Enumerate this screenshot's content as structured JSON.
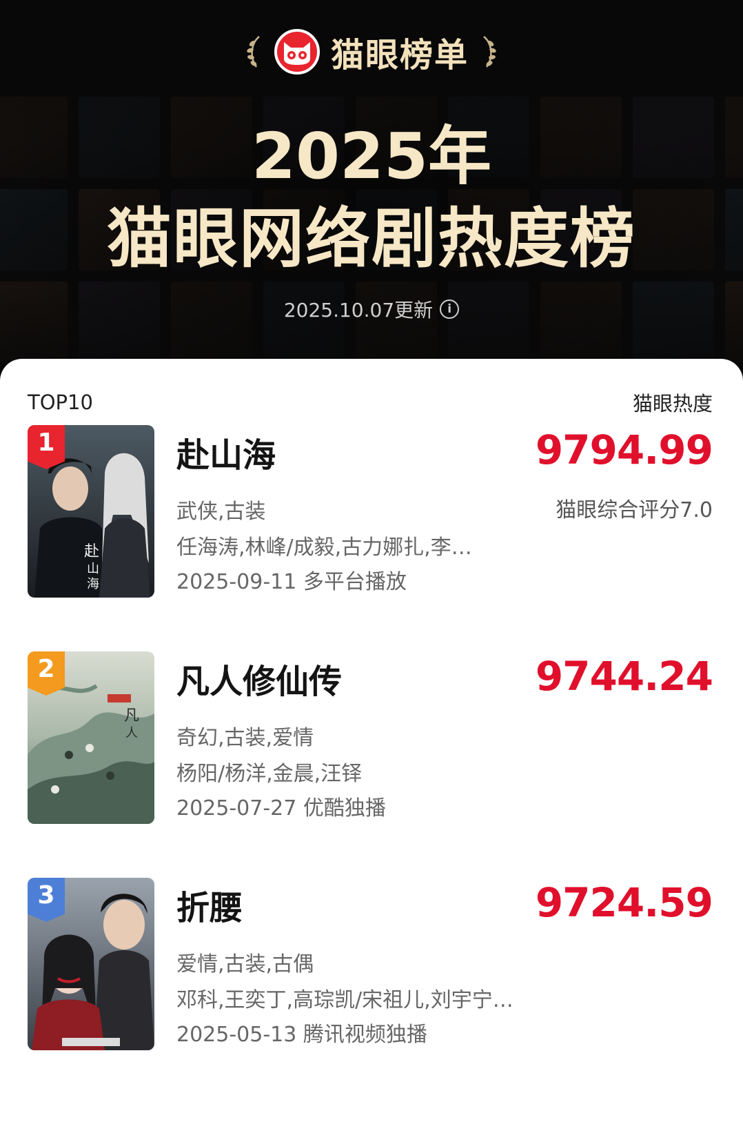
{
  "header": {
    "brand_name": "猫眼榜单",
    "year": "2025年",
    "title": "猫眼网络剧热度榜",
    "update": "2025.10.07更新"
  },
  "list": {
    "left_label": "TOP10",
    "right_label": "猫眼热度",
    "items": [
      {
        "rank": "1",
        "title": "赴山海",
        "score": "9794.99",
        "subscore": "猫眼综合评分7.0",
        "genre": "武侠,古装",
        "cast": "任海涛,林峰/成毅,古力娜扎,李…",
        "date": "2025-09-11 多平台播放",
        "badge_color": "#e8242f"
      },
      {
        "rank": "2",
        "title": "凡人修仙传",
        "score": "9744.24",
        "subscore": "",
        "genre": "奇幻,古装,爱情",
        "cast": "杨阳/杨洋,金晨,汪铎",
        "date": "2025-07-27 优酷独播",
        "badge_color": "#f39a1f"
      },
      {
        "rank": "3",
        "title": "折腰",
        "score": "9724.59",
        "subscore": "",
        "genre": "爱情,古装,古偶",
        "cast": "邓科,王奕丁,高琮凯/宋祖儿,刘宇宁…",
        "date": "2025-05-13 腾讯视频独播",
        "badge_color": "#4e7fd6"
      }
    ]
  },
  "colors": {
    "accent": "#e0102c",
    "title_gold": "#f6e7c6"
  },
  "icons": [
    "laurel-left-icon",
    "maoyan-cat-logo-icon",
    "laurel-right-icon",
    "info-icon"
  ]
}
